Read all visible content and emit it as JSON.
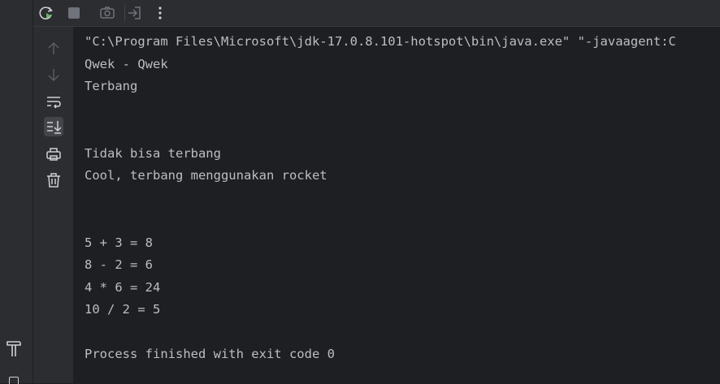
{
  "console": {
    "lines": [
      "\"C:\\Program Files\\Microsoft\\jdk-17.0.8.101-hotspot\\bin\\java.exe\" \"-javaagent:C",
      "Qwek - Qwek",
      "Terbang",
      "",
      "",
      "Tidak bisa terbang",
      "Cool, terbang menggunakan rocket",
      "",
      "",
      "5 + 3 = 8",
      "8 - 2 = 6",
      "4 * 6 = 24",
      "10 / 2 = 5",
      "",
      "Process finished with exit code 0"
    ]
  },
  "toolbar": {
    "icons": [
      "rerun-icon",
      "stop-icon",
      "camera-icon",
      "exit-icon",
      "more-vertical-icon"
    ]
  },
  "gutter": {
    "icons": [
      "arrow-up-icon",
      "arrow-down-icon",
      "soft-wrap-icon",
      "scroll-to-end-icon",
      "print-icon",
      "trash-icon"
    ],
    "active": "scroll-to-end-icon"
  },
  "colors": {
    "background": "#1e1f22",
    "panel": "#2b2d30",
    "text": "#bcbec4",
    "rerun_accent": "#5fb865"
  }
}
